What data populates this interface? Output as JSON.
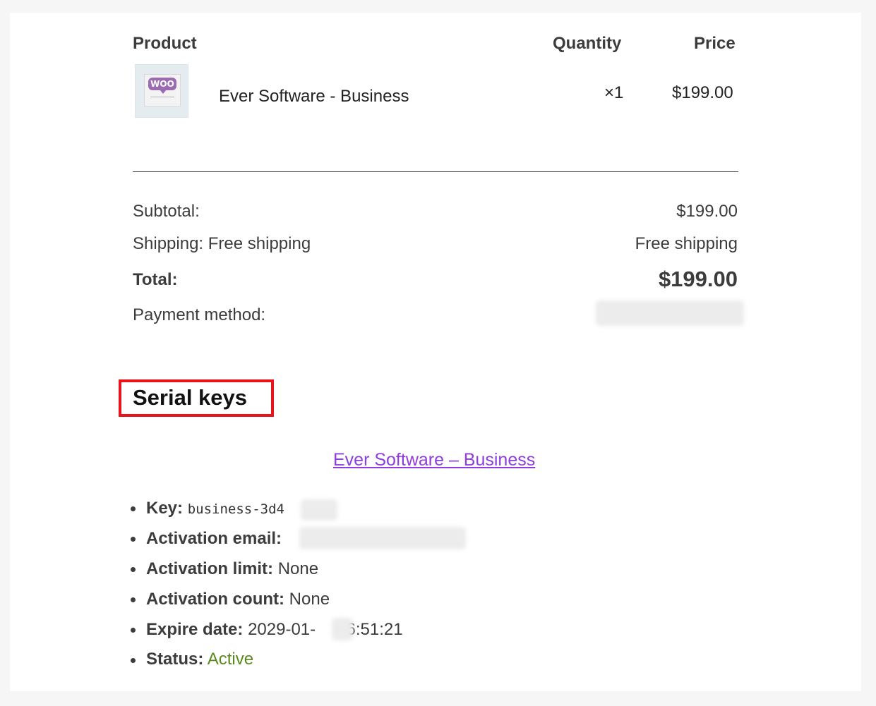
{
  "table": {
    "headers": {
      "product": "Product",
      "quantity": "Quantity",
      "price": "Price"
    },
    "item": {
      "name": "Ever Software - Business",
      "quantity": "×1",
      "price": "$199.00",
      "thumbnail_text": "WOO"
    }
  },
  "totals": {
    "subtotal_label": "Subtotal:",
    "subtotal_value": "$199.00",
    "shipping_label": "Shipping: Free shipping",
    "shipping_value": "Free shipping",
    "total_label": "Total:",
    "total_value": "$199.00",
    "payment_label": "Payment method:"
  },
  "serial": {
    "title": "Serial keys",
    "product_link": "Ever Software – Business",
    "items": [
      {
        "label": "Key:",
        "value": "business-3d4"
      },
      {
        "label": "Activation email:",
        "value": ""
      },
      {
        "label": "Activation limit:",
        "value": "None"
      },
      {
        "label": "Activation count:",
        "value": "None"
      },
      {
        "label": "Expire date:",
        "value_a": "2029-01-",
        "value_b": "16:51:21"
      },
      {
        "label": "Status:",
        "value": "Active"
      }
    ]
  },
  "colors": {
    "highlight_box": "#e8141b",
    "link": "#8f3ddf",
    "status_active": "#5a8a1f"
  }
}
